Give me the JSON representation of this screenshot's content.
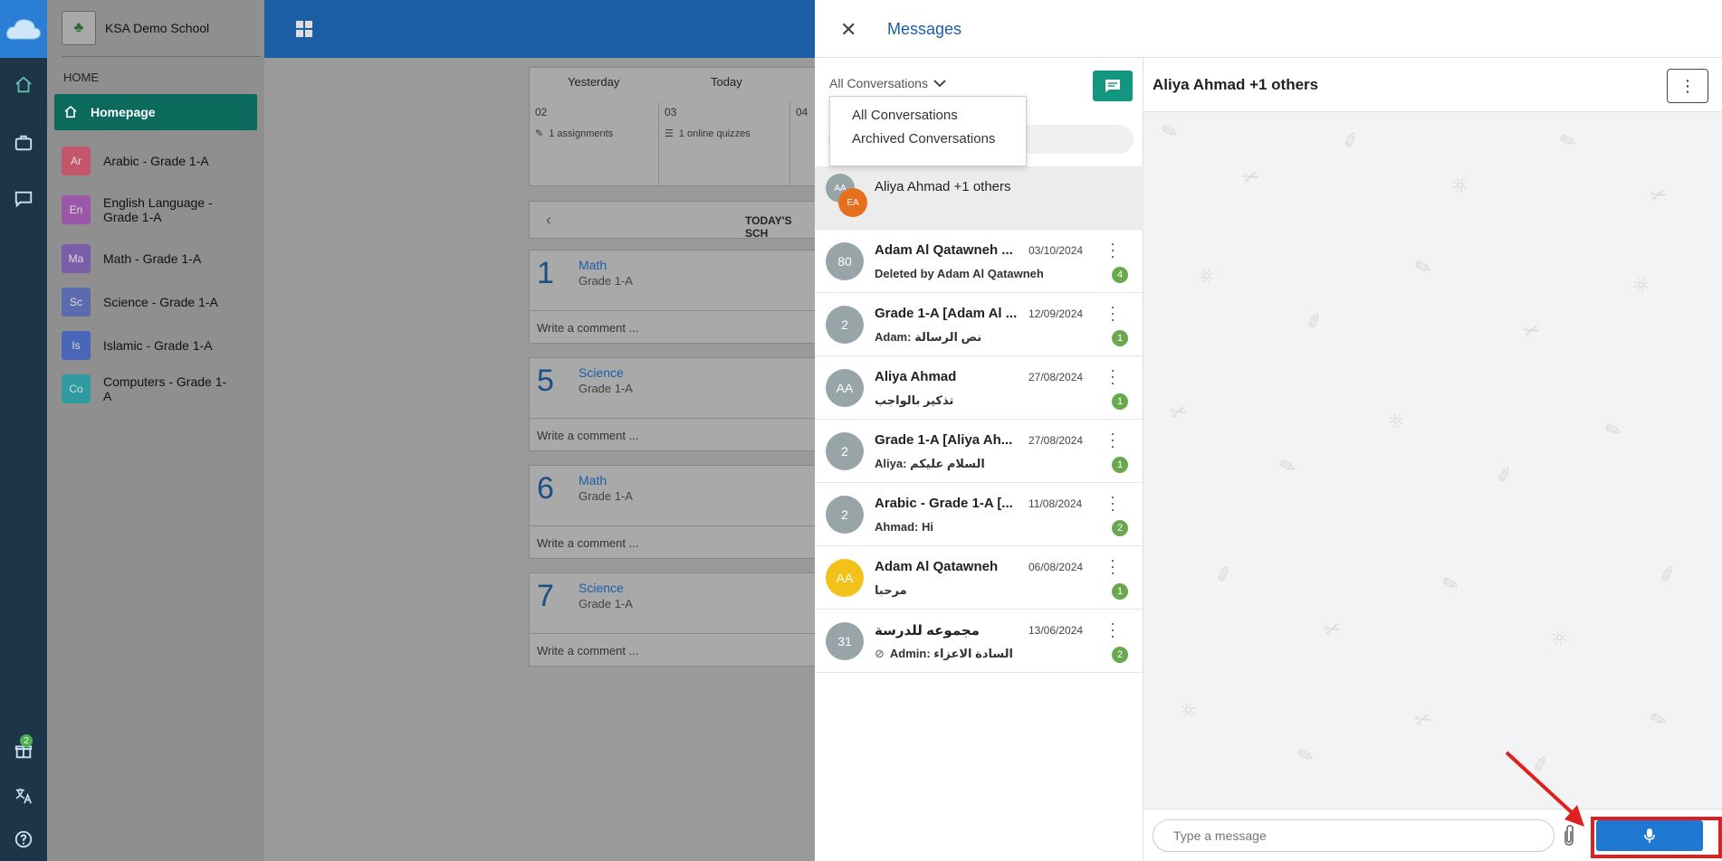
{
  "school": {
    "name": "KSA Demo School",
    "home_label": "HOME",
    "homepage_label": "Homepage"
  },
  "rail": {
    "gift_badge": "2"
  },
  "courses": [
    {
      "abbr": "Ar",
      "name": "Arabic - Grade 1-A",
      "color": "#c2566b"
    },
    {
      "abbr": "En",
      "name": "English Language - Grade 1-A",
      "color": "#9b57a8"
    },
    {
      "abbr": "Ma",
      "name": "Math - Grade 1-A",
      "color": "#7a5ea8"
    },
    {
      "abbr": "Sc",
      "name": "Science - Grade 1-A",
      "color": "#5b6bae"
    },
    {
      "abbr": "Is",
      "name": "Islamic - Grade 1-A",
      "color": "#4a66b8"
    },
    {
      "abbr": "Co",
      "name": "Computers - Grade 1-A",
      "color": "#2f9aa0"
    }
  ],
  "calendar": {
    "days": [
      "Yesterday",
      "Today"
    ],
    "cells": [
      {
        "num": "02",
        "item": "1 assignments"
      },
      {
        "num": "03",
        "item": "1 online quizzes"
      },
      {
        "num": "04",
        "item": ""
      }
    ]
  },
  "schedule": {
    "title": "TODAY'S SCH",
    "lessons": [
      {
        "num": "1",
        "subject": "Math",
        "grade": "Grade 1-A",
        "comment": "Write a comment ..."
      },
      {
        "num": "5",
        "subject": "Science",
        "grade": "Grade 1-A",
        "comment": "Write a comment ..."
      },
      {
        "num": "6",
        "subject": "Math",
        "grade": "Grade 1-A",
        "comment": "Write a comment ..."
      },
      {
        "num": "7",
        "subject": "Science",
        "grade": "Grade 1-A",
        "comment": "Write a comment ..."
      }
    ]
  },
  "messages": {
    "title": "Messages",
    "filter_selected": "All Conversations",
    "filter_options": [
      "All Conversations",
      "Archived Conversations"
    ],
    "active_conversation": {
      "name": "Aliya Ahmad +1 others",
      "avatar1": "AA",
      "avatar2": "EA"
    },
    "conversations": [
      {
        "avatar": "80",
        "avatar_color": "#98a5a8",
        "name": "Adam Al Qatawneh ...",
        "date": "03/10/2024",
        "preview": "Deleted by Adam Al Qatawneh",
        "unread": "4"
      },
      {
        "avatar": "2",
        "avatar_color": "#98a5a8",
        "name": "Grade 1-A [Adam Al ...",
        "date": "12/09/2024",
        "preview": "Adam: نص الرسالة",
        "unread": "1"
      },
      {
        "avatar": "AA",
        "avatar_color": "#98a5a8",
        "name": "Aliya Ahmad",
        "date": "27/08/2024",
        "preview": "تذكير بالواجب",
        "unread": "1"
      },
      {
        "avatar": "2",
        "avatar_color": "#98a5a8",
        "name": "Grade 1-A [Aliya Ah...",
        "date": "27/08/2024",
        "preview": "Aliya: السلام عليكم",
        "unread": "1"
      },
      {
        "avatar": "2",
        "avatar_color": "#98a5a8",
        "name": "Arabic - Grade 1-A [...",
        "date": "11/08/2024",
        "preview": "Ahmad: Hi",
        "unread": "2"
      },
      {
        "avatar": "AA",
        "avatar_color": "#f2c21a",
        "name": "Adam Al Qatawneh",
        "date": "06/08/2024",
        "preview": "مرحبا",
        "unread": "1"
      },
      {
        "avatar": "31",
        "avatar_color": "#98a5a8",
        "name": "مجموعه للدرسة",
        "date": "13/06/2024",
        "preview": "Admin: السادة الاعزاء",
        "unread": "2"
      }
    ],
    "chat_title": "Aliya Ahmad +1 others",
    "composer_placeholder": "Type a message"
  }
}
